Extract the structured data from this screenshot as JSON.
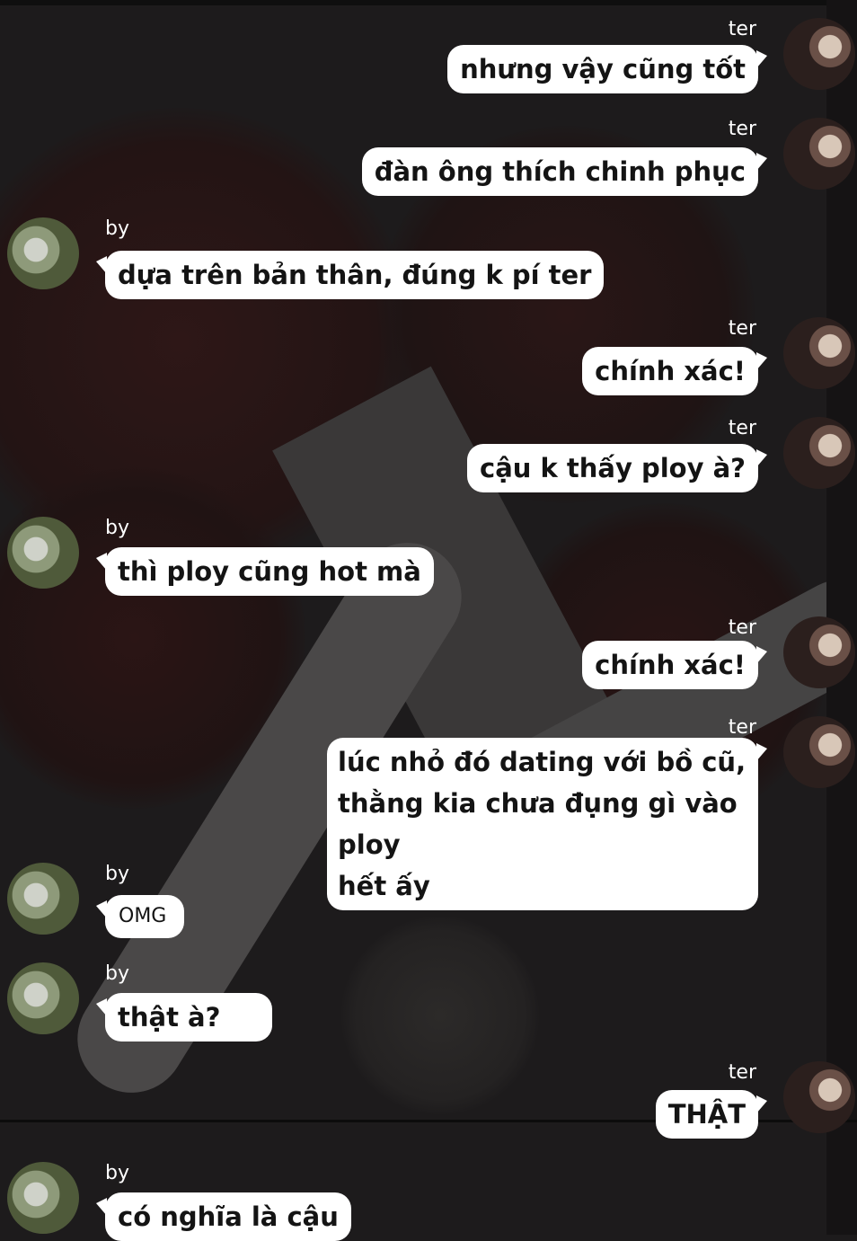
{
  "messages": [
    {
      "sender": "ter",
      "text": "nhưng vậy cũng tốt"
    },
    {
      "sender": "ter",
      "text": "đàn ông thích chinh phục"
    },
    {
      "sender": "by",
      "text": "dựa trên bản thân, đúng k pí ter"
    },
    {
      "sender": "ter",
      "text": "chính xác!"
    },
    {
      "sender": "ter",
      "text": "cậu k thấy ploy à?"
    },
    {
      "sender": "by",
      "text": "thì ploy cũng hot mà"
    },
    {
      "sender": "ter",
      "text": "chính xác!"
    },
    {
      "sender": "ter",
      "text": "lúc nhỏ đó dating với bồ cũ,",
      "text2": "thằng kia chưa đụng gì vào ploy",
      "text3": "hết ấy"
    },
    {
      "sender": "by",
      "text": "OMG"
    },
    {
      "sender": "by",
      "text": "thật à?"
    },
    {
      "sender": "ter",
      "text": "THẬT"
    },
    {
      "sender": "by",
      "text": "có nghĩa là cậu"
    }
  ],
  "colors": {
    "background": "#1d1b1c",
    "bubble": "#ffffff",
    "name": "#ffffff"
  }
}
